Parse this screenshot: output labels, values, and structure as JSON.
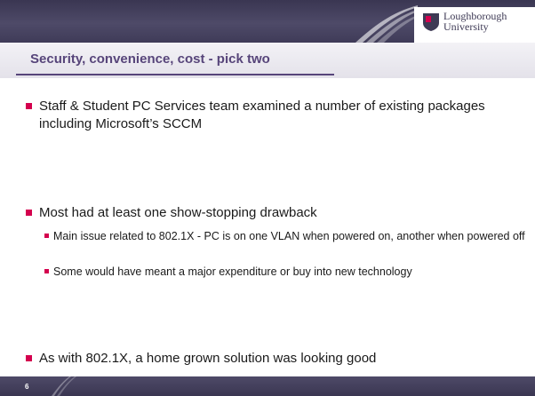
{
  "header": {
    "logo_line1": "Loughborough",
    "logo_line2": "University"
  },
  "slide": {
    "title": "Security, convenience, cost - pick two",
    "page_number": "6"
  },
  "bullets": [
    {
      "text": "Staff & Student PC Services team examined a number of existing packages including Microsoft’s SCCM"
    },
    {
      "text": "Most had at least one show-stopping drawback",
      "sub": [
        "Main issue related to 802.1X - PC is on one VLAN when powered on, another when powered off",
        "Some would have meant a major expenditure or buy into new technology"
      ]
    },
    {
      "text": "As with 802.1X, a home grown solution was looking good"
    }
  ],
  "colors": {
    "band": "#3f3b58",
    "title": "#57457a",
    "bullet": "#d4004e",
    "logo_shield": "#d4004e"
  }
}
